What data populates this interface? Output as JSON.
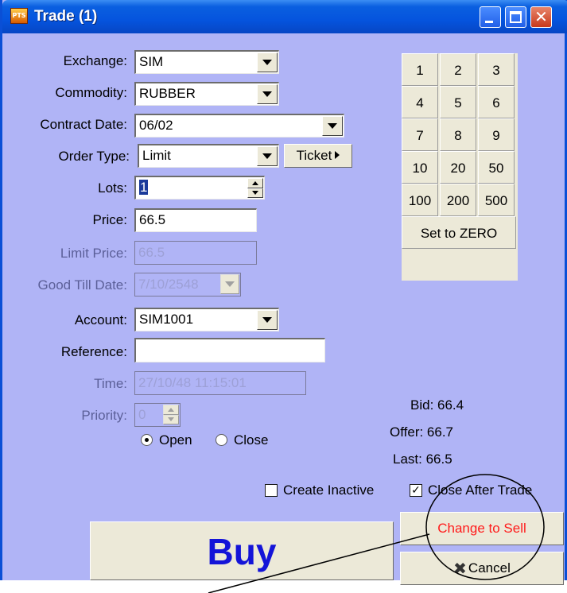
{
  "window": {
    "title": "Trade (1)",
    "icon_text": "PTS"
  },
  "form": {
    "exchange": {
      "label": "Exchange:",
      "value": "SIM"
    },
    "commodity": {
      "label": "Commodity:",
      "value": "RUBBER"
    },
    "contract_date": {
      "label": "Contract Date:",
      "value": "06/02"
    },
    "order_type": {
      "label": "Order Type:",
      "value": "Limit"
    },
    "ticket_label": "Ticket",
    "lots": {
      "label": "Lots:",
      "value": "1"
    },
    "price": {
      "label": "Price:",
      "value": "66.5"
    },
    "limit_price": {
      "label": "Limit Price:",
      "value": "66.5"
    },
    "good_till_date": {
      "label": "Good Till Date:",
      "value": "7/10/2548"
    },
    "account": {
      "label": "Account:",
      "value": "SIM1001"
    },
    "reference": {
      "label": "Reference:",
      "value": ""
    },
    "time": {
      "label": "Time:",
      "value": "27/10/48 11:15:01"
    },
    "priority": {
      "label": "Priority:",
      "value": "0"
    },
    "open_label": "Open",
    "close_label": "Close"
  },
  "keypad": {
    "rows": [
      [
        "1",
        "2",
        "3"
      ],
      [
        "4",
        "5",
        "6"
      ],
      [
        "7",
        "8",
        "9"
      ],
      [
        "10",
        "20",
        "50"
      ],
      [
        "100",
        "200",
        "500"
      ]
    ],
    "zero_label": "Set to ZERO"
  },
  "quotes": {
    "bid": "Bid: 66.4",
    "offer": "Offer: 66.7",
    "last": "Last: 66.5"
  },
  "options": {
    "create_inactive": {
      "label": "Create Inactive",
      "checked": false
    },
    "close_after_trade": {
      "label": "Close After Trade",
      "checked": true
    }
  },
  "actions": {
    "buy": "Buy",
    "change_to_sell": "Change to Sell",
    "cancel": "Cancel"
  },
  "colors": {
    "window_bg": "#b0b4f6",
    "titlebar": "#0554de",
    "buy_text": "#1414d8",
    "sell_text": "#ff1a1a"
  }
}
